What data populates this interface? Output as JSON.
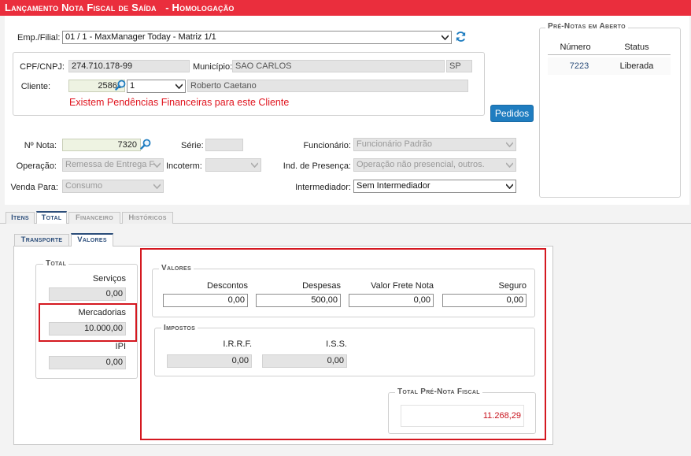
{
  "title": "Lançamento Nota Fiscal de Saída",
  "title_suffix": "- Homologação",
  "emp_filial": {
    "label": "Emp./Filial:",
    "value": "01 / 1 - MaxManager Today - Matriz 1/1"
  },
  "cpf_cnpj": {
    "label": "CPF/CNPJ:",
    "value": "274.710.178-99"
  },
  "municipio": {
    "label": "Município:",
    "value": "SAO CARLOS",
    "uf": "SP"
  },
  "cliente": {
    "label": "Cliente:",
    "code": "25865",
    "seq": "1",
    "name": "Roberto Caetano"
  },
  "warning": "Existem Pendências Financeiras para este Cliente",
  "pedidos_button": "Pedidos",
  "nota": {
    "label": "Nº Nota:",
    "value": "7320"
  },
  "serie": {
    "label": "Série:",
    "value": ""
  },
  "funcionario": {
    "label": "Funcionário:",
    "value": "Funcionário Padrão"
  },
  "operacao": {
    "label": "Operação:",
    "value": "Remessa de Entrega F"
  },
  "incoterm": {
    "label": "Incoterm:",
    "value": ""
  },
  "ind_presenca": {
    "label": "Ind. de Presença:",
    "value": "Operação não presencial, outros."
  },
  "venda_para": {
    "label": "Venda Para:",
    "value": "Consumo"
  },
  "intermediador": {
    "label": "Intermediador:",
    "value": "Sem Intermediador"
  },
  "pre_notas": {
    "title": "Pré-Notas em Aberto",
    "headers": [
      "Número",
      "Status"
    ],
    "rows": [
      {
        "numero": "7223",
        "status": "Liberada"
      }
    ]
  },
  "main_tabs": [
    "Itens",
    "Total",
    "Financeiro",
    "Históricos"
  ],
  "sub_tabs": [
    "Transporte",
    "Valores"
  ],
  "total": {
    "legend": "Total",
    "servicos_label": "Serviços",
    "servicos_value": "0,00",
    "mercadorias_label": "Mercadorias",
    "mercadorias_value": "10.000,00",
    "ipi_label": "IPI",
    "ipi_value": "0,00"
  },
  "valores": {
    "legend": "Valores",
    "descontos_label": "Descontos",
    "descontos_value": "0,00",
    "despesas_label": "Despesas",
    "despesas_value": "500,00",
    "frete_label": "Valor Frete Nota",
    "frete_value": "0,00",
    "seguro_label": "Seguro",
    "seguro_value": "0,00"
  },
  "impostos": {
    "legend": "Impostos",
    "irrf_label": "I.R.R.F.",
    "irrf_value": "0,00",
    "iss_label": "I.S.S.",
    "iss_value": "0,00"
  },
  "total_pre_nota": {
    "legend": "Total Pré-Nota Fiscal",
    "value": "11.268,29"
  },
  "colors": {
    "title_bar": "#ea2e3d",
    "accent": "#1f7dc0",
    "highlight_border": "#d41820",
    "total_value": "#c8141e"
  }
}
